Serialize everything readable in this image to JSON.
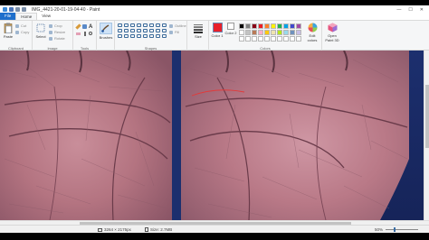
{
  "window": {
    "title": "IMG_4421-20-01-19-04-40 - Paint",
    "minimize": "—",
    "maximize": "☐",
    "close": "✕"
  },
  "tabs": [
    {
      "label": "File"
    },
    {
      "label": "Home"
    },
    {
      "label": "View"
    }
  ],
  "ribbon": {
    "clipboard": {
      "group_label": "Clipboard",
      "paste": "Paste",
      "cut": "Cut",
      "copy": "Copy"
    },
    "image": {
      "group_label": "Image",
      "select": "Select",
      "crop": "Crop",
      "resize": "Resize",
      "rotate": "Rotate"
    },
    "tools": {
      "group_label": "Tools"
    },
    "brushes": {
      "label": "Brushes"
    },
    "shapes": {
      "group_label": "Shapes",
      "outline": "Outline",
      "fill": "Fill"
    },
    "size": {
      "label": "Size"
    },
    "colors": {
      "group_label": "Colors",
      "color1": "Color 1",
      "color2": "Color 2",
      "edit_colors": "Edit colors",
      "color1_value": "#e8202a",
      "color2_value": "#ffffff",
      "palette": [
        "#000000",
        "#7f7f7f",
        "#880015",
        "#ed1c24",
        "#ff7f27",
        "#fff200",
        "#22b14c",
        "#00a2e8",
        "#3f48cc",
        "#a349a4",
        "#ffffff",
        "#c3c3c3",
        "#b97a57",
        "#ffaec9",
        "#ffc90e",
        "#efe4b0",
        "#b5e61d",
        "#99d9ea",
        "#7092be",
        "#c8bfe7",
        "#ffffff",
        "#ffffff",
        "#ffffff",
        "#ffffff",
        "#ffffff",
        "#ffffff",
        "#ffffff",
        "#ffffff",
        "#ffffff",
        "#ffffff"
      ]
    },
    "paint3d": {
      "label": "Open Paint 3D"
    }
  },
  "status": {
    "dimensions": "3264 × 2175px",
    "size": "Size: 2.7MB",
    "zoom": "50%",
    "zoom_level": 0.5
  }
}
